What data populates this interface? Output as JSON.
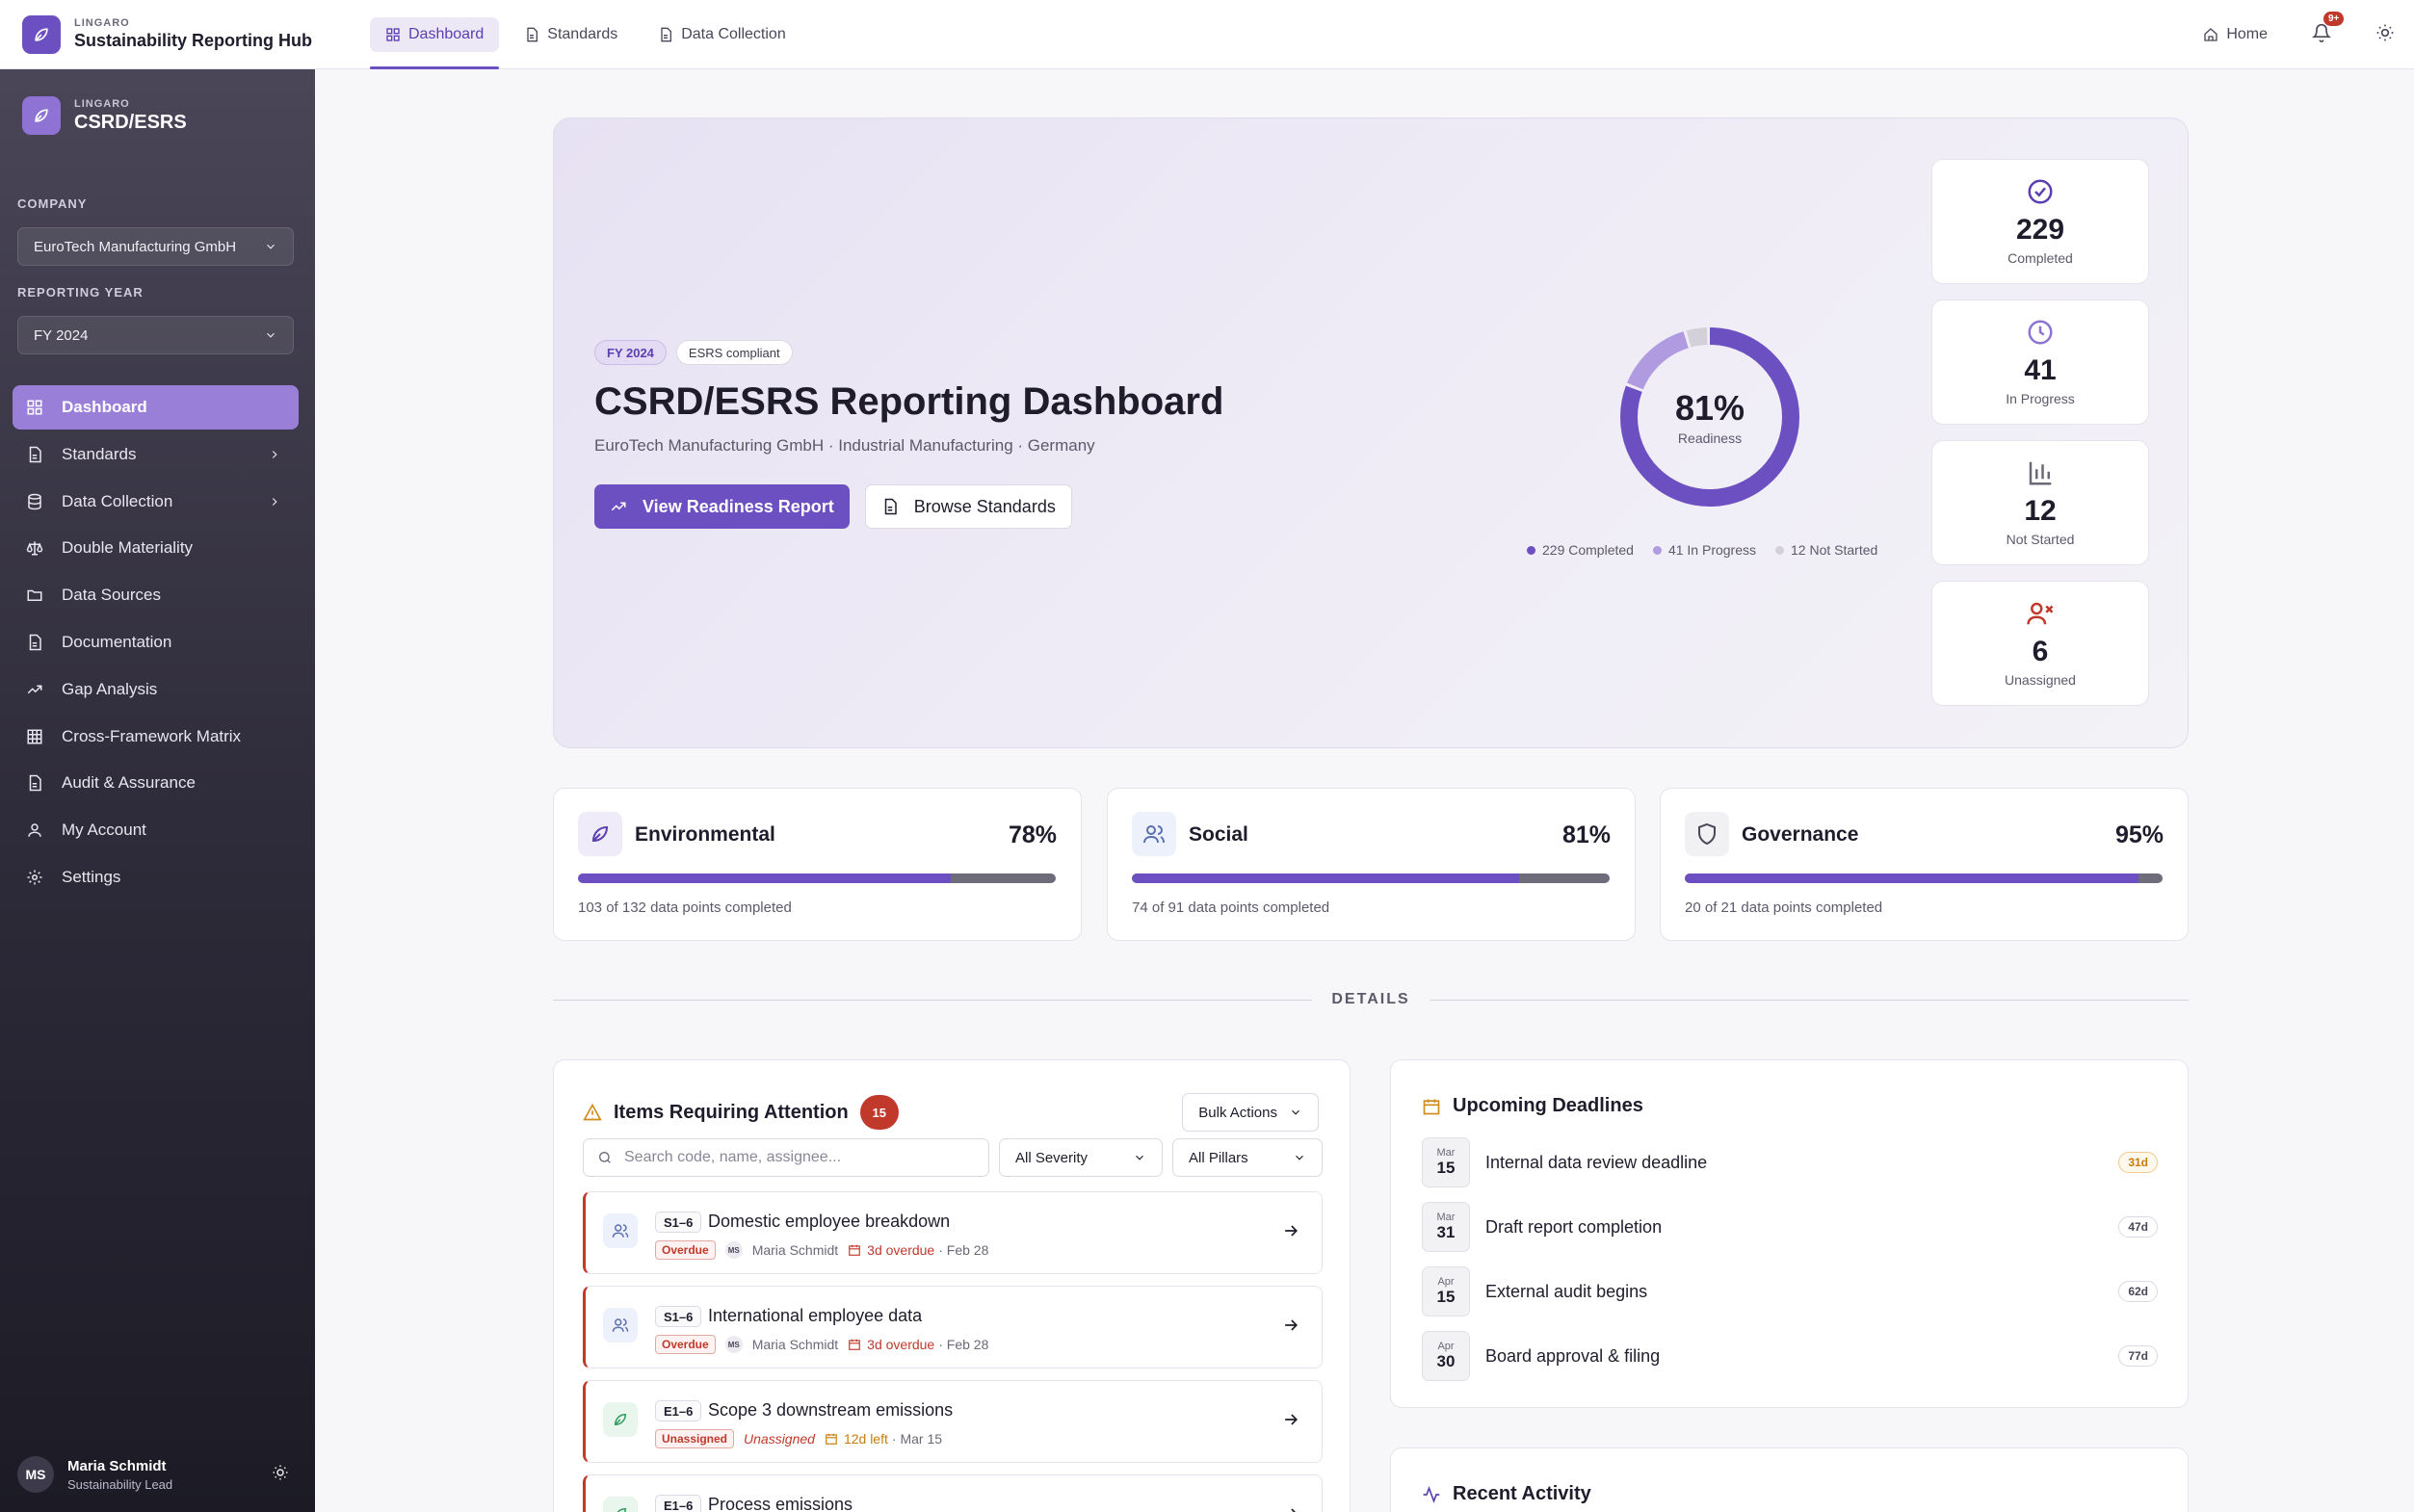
{
  "topbar": {
    "brand_small": "LINGARO",
    "brand_title": "Sustainability Reporting Hub",
    "nav": [
      {
        "label": "Dashboard",
        "icon": "grid-icon",
        "active": true
      },
      {
        "label": "Standards",
        "icon": "document-icon",
        "active": false
      },
      {
        "label": "Data Collection",
        "icon": "document-icon",
        "active": false
      }
    ],
    "home_label": "Home",
    "notification_badge": "9+",
    "accent_color": "#6c4fc0"
  },
  "sidebar": {
    "brand_small": "LINGARO",
    "brand_title": "CSRD/ESRS",
    "company_label": "COMPANY",
    "company_value": "EuroTech Manufacturing GmbH",
    "year_label": "REPORTING YEAR",
    "year_value": "FY 2024",
    "items": [
      {
        "label": "Dashboard",
        "icon": "grid-icon",
        "active": true
      },
      {
        "label": "Standards",
        "icon": "document-icon",
        "chevron": true
      },
      {
        "label": "Data Collection",
        "icon": "database-icon",
        "chevron": true
      },
      {
        "label": "Double Materiality",
        "icon": "scale-icon"
      },
      {
        "label": "Data Sources",
        "icon": "folder-icon"
      },
      {
        "label": "Documentation",
        "icon": "document-icon"
      },
      {
        "label": "Gap Analysis",
        "icon": "trend-icon"
      },
      {
        "label": "Cross-Framework Matrix",
        "icon": "table-icon"
      },
      {
        "label": "Audit & Assurance",
        "icon": "document-icon"
      },
      {
        "label": "My Account",
        "icon": "user-icon"
      },
      {
        "label": "Settings",
        "icon": "gear-icon"
      }
    ],
    "user": {
      "initials": "MS",
      "name": "Maria Schmidt",
      "role": "Sustainability Lead"
    }
  },
  "hero": {
    "pill_year": "FY 2024",
    "pill_status": "ESRS compliant",
    "title": "CSRD/ESRS Reporting Dashboard",
    "subtitle": "EuroTech Manufacturing GmbH · Industrial Manufacturing · Germany",
    "primary_button": "View Readiness Report",
    "secondary_button": "Browse Standards",
    "readiness_pct": "81%",
    "readiness_label": "Readiness",
    "legend": [
      {
        "label": "229 Completed",
        "color": "#6c4fc0"
      },
      {
        "label": "41 In Progress",
        "color": "#b09be0"
      },
      {
        "label": "12 Not Started",
        "color": "#d3d0d9"
      }
    ]
  },
  "chart_data": {
    "type": "pie",
    "categories": [
      "Completed",
      "In Progress",
      "Not Started"
    ],
    "values": [
      229,
      41,
      12
    ],
    "colors": [
      "#6c4fc0",
      "#b09be0",
      "#d3d0d9"
    ]
  },
  "stats": [
    {
      "value": "229",
      "label": "Completed",
      "icon": "check-circle-icon",
      "color": "#5b3fb0"
    },
    {
      "value": "41",
      "label": "In Progress",
      "icon": "clock-icon",
      "color": "#8e73d4"
    },
    {
      "value": "12",
      "label": "Not Started",
      "icon": "bar-chart-icon",
      "color": "#6b6878"
    },
    {
      "value": "6",
      "label": "Unassigned",
      "icon": "user-x-icon",
      "color": "#c0392b"
    }
  ],
  "pillars": [
    {
      "name": "Environmental",
      "pct": "78%",
      "fraction": 0.78,
      "desc": "103 of 132 data points completed",
      "icon": "leaf-icon"
    },
    {
      "name": "Social",
      "pct": "81%",
      "fraction": 0.81,
      "desc": "74 of 91 data points completed",
      "icon": "users-icon"
    },
    {
      "name": "Governance",
      "pct": "95%",
      "fraction": 0.95,
      "desc": "20 of 21 data points completed",
      "icon": "shield-icon"
    }
  ],
  "details_label": "DETAILS",
  "attention": {
    "title": "Items Requiring Attention",
    "count": "15",
    "bulk_label": "Bulk Actions",
    "search_placeholder": "Search code, name, assignee...",
    "severity_filter": "All Severity",
    "pillar_filter": "All Pillars",
    "rows": [
      {
        "code": "S1–6",
        "name": "Domestic employee breakdown",
        "tag": "Overdue",
        "assignee_initials": "MS",
        "assignee": "Maria Schmidt",
        "due_text": "3d overdue",
        "due_date": "· Feb 28",
        "icon": "users-icon",
        "kind": "social"
      },
      {
        "code": "S1–6",
        "name": "International employee data",
        "tag": "Overdue",
        "assignee_initials": "MS",
        "assignee": "Maria Schmidt",
        "due_text": "3d overdue",
        "due_date": "· Feb 28",
        "icon": "users-icon",
        "kind": "social"
      },
      {
        "code": "E1–6",
        "name": "Scope 3 downstream emissions",
        "tag": "Unassigned",
        "assignee_initials": "",
        "assignee": "Unassigned",
        "due_text": "12d left",
        "due_date": "· Mar 15",
        "icon": "leaf-icon",
        "kind": "env"
      },
      {
        "code": "E1–6",
        "name": "Process emissions",
        "tag": "",
        "assignee_initials": "",
        "assignee": "",
        "due_text": "",
        "due_date": "",
        "icon": "leaf-icon",
        "kind": "env"
      }
    ]
  },
  "deadlines": {
    "title": "Upcoming Deadlines",
    "rows": [
      {
        "month": "Mar",
        "day": "15",
        "name": "Internal data review deadline",
        "days": "31d",
        "warn": true
      },
      {
        "month": "Mar",
        "day": "31",
        "name": "Draft report completion",
        "days": "47d",
        "warn": false
      },
      {
        "month": "Apr",
        "day": "15",
        "name": "External audit begins",
        "days": "62d",
        "warn": false
      },
      {
        "month": "Apr",
        "day": "30",
        "name": "Board approval & filing",
        "days": "77d",
        "warn": false
      }
    ]
  },
  "activity": {
    "title": "Recent Activity"
  }
}
